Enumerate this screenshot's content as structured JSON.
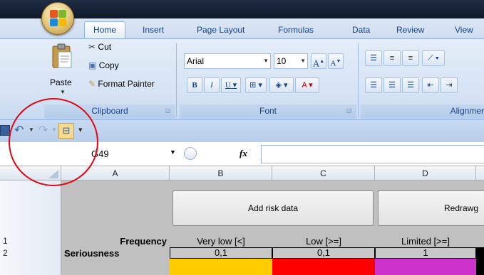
{
  "tabs": [
    "Home",
    "Insert",
    "Page Layout",
    "Formulas",
    "Data",
    "Review",
    "View"
  ],
  "clipboard": {
    "paste_label": "Paste",
    "cut_label": "Cut",
    "copy_label": "Copy",
    "format_painter_label": "Format Painter",
    "group_label": "Clipboard"
  },
  "font": {
    "font_name": "Arial",
    "font_size": "10",
    "group_label": "Font",
    "bold": "B",
    "italic": "I",
    "underline": "U",
    "grow": "A",
    "shrink": "A"
  },
  "alignment": {
    "group_label": "Alignmer"
  },
  "formula_bar": {
    "name_box": "G49",
    "fx_label": "fx",
    "formula": ""
  },
  "grid": {
    "columns": [
      "A",
      "B",
      "C",
      "D"
    ],
    "buttons": {
      "add_risk": "Add risk data",
      "redraw": "Redrawg"
    },
    "rows": [
      {
        "num": "1",
        "cells": [
          "Frequency",
          "Very low [<]",
          "Low [>=]",
          "Limited [>=]"
        ]
      },
      {
        "num": "2",
        "cells": [
          "Seriousness",
          "0,1",
          "0,1",
          "1"
        ]
      }
    ],
    "swatches": [
      "#ffcc00",
      "#ff0000",
      "#cc33cc",
      "#000000"
    ]
  },
  "annotation_color": "#e30613"
}
